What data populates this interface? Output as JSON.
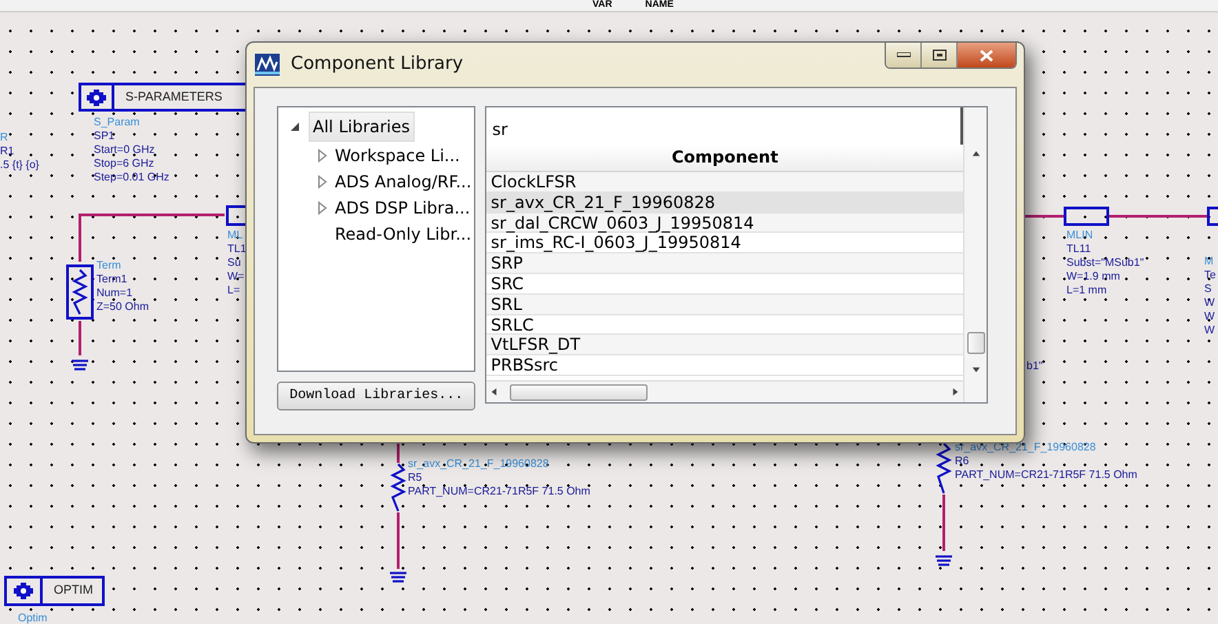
{
  "toolbar": {
    "items": [
      {
        "label": "VAR"
      },
      {
        "label": "NAME"
      }
    ]
  },
  "schematic": {
    "left_cut_labels": [
      "R",
      "R1",
      ".5 {t} {o}"
    ],
    "sparameters": {
      "title": "S-PARAMETERS",
      "lines": [
        "S_Param",
        "SP1",
        "Start=0 GHz",
        "Stop=6 GHz",
        "Step=0.01 GHz"
      ]
    },
    "term": {
      "lines": [
        "Term",
        "Term1",
        "Num=1",
        "Z=50 Ohm"
      ]
    },
    "mlin_left": {
      "lines": [
        "ML",
        "TL1",
        "Su",
        "W=",
        "L="
      ]
    },
    "mlin_right": {
      "lines": [
        "MLIN",
        "TL11",
        "Subst=\"MSub1\"",
        "W=1.9 mm",
        "L=1 mm"
      ]
    },
    "right_cut_labels": [
      "M",
      "Te",
      "S",
      "W",
      "W",
      "W"
    ],
    "fragment": "b1\"",
    "resistors": [
      {
        "lines": [
          "sr_avx_CR_21_F_19960828",
          "R5",
          "PART_NUM=CR21-71R5F 71.5 Ohm"
        ]
      },
      {
        "lines": [
          "sr_avx_CR_21_F_19960828",
          "R6",
          "PART_NUM=CR21-71R5F 71.5 Ohm"
        ]
      }
    ],
    "optim": {
      "title": "OPTIM",
      "label": "Optim"
    }
  },
  "dialog": {
    "title": "Component Library",
    "tree": [
      {
        "label": "All Libraries",
        "selected": true,
        "expanded": true,
        "children": [
          {
            "label": "Workspace Li...",
            "selected": false,
            "expandable": true
          },
          {
            "label": "ADS Analog/RF...",
            "selected": false,
            "expandable": true
          },
          {
            "label": "ADS DSP Libra...",
            "selected": false,
            "expandable": true
          },
          {
            "label": "Read-Only Libr...",
            "selected": false,
            "expandable": false
          }
        ]
      }
    ],
    "download_button": "Download Libraries...",
    "search": {
      "value": "sr"
    },
    "column": "Component",
    "rows": [
      {
        "name": "ClockLFSR",
        "selected": false
      },
      {
        "name": "sr_avx_CR_21_F_19960828",
        "selected": true
      },
      {
        "name": "sr_dal_CRCW_0603_J_19950814",
        "selected": false
      },
      {
        "name": "sr_ims_RC-I_0603_J_19950814",
        "selected": false
      },
      {
        "name": "SRP",
        "selected": false
      },
      {
        "name": "SRC",
        "selected": false
      },
      {
        "name": "SRL",
        "selected": false
      },
      {
        "name": "SRLC",
        "selected": false
      },
      {
        "name": "VtLFSR_DT",
        "selected": false
      },
      {
        "name": "PRBSsrc",
        "selected": false
      }
    ]
  }
}
